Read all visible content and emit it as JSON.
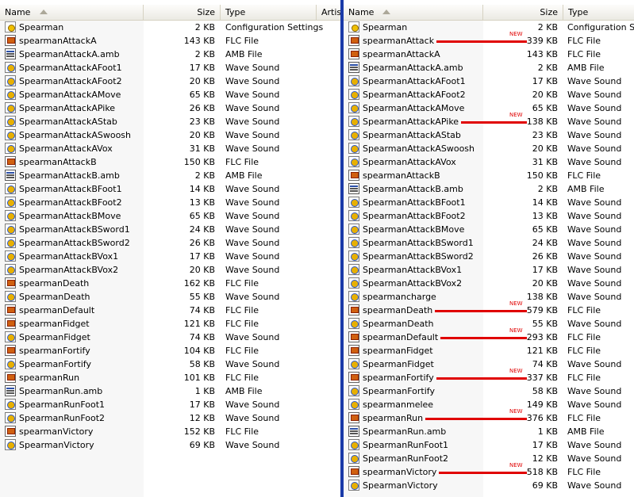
{
  "left": {
    "columns": {
      "name": "Name",
      "size": "Size",
      "type": "Type",
      "artist": "Artis"
    },
    "files": [
      {
        "name": "Spearman",
        "size": "2 KB",
        "type": "Configuration Settings",
        "icon": "config-icon"
      },
      {
        "name": "spearmanAttackA",
        "size": "143 KB",
        "type": "FLC File",
        "icon": "flc-icon"
      },
      {
        "name": "SpearmanAttackA.amb",
        "size": "2 KB",
        "type": "AMB File",
        "icon": "amb-icon"
      },
      {
        "name": "SpearmanAttackAFoot1",
        "size": "17 KB",
        "type": "Wave Sound",
        "icon": "wave-icon"
      },
      {
        "name": "SpearmanAttackAFoot2",
        "size": "20 KB",
        "type": "Wave Sound",
        "icon": "wave-icon"
      },
      {
        "name": "SpearmanAttackAMove",
        "size": "65 KB",
        "type": "Wave Sound",
        "icon": "wave-icon"
      },
      {
        "name": "SpearmanAttackAPike",
        "size": "26 KB",
        "type": "Wave Sound",
        "icon": "wave-icon"
      },
      {
        "name": "SpearmanAttackAStab",
        "size": "23 KB",
        "type": "Wave Sound",
        "icon": "wave-icon"
      },
      {
        "name": "SpearmanAttackASwoosh",
        "size": "20 KB",
        "type": "Wave Sound",
        "icon": "wave-icon"
      },
      {
        "name": "SpearmanAttackAVox",
        "size": "31 KB",
        "type": "Wave Sound",
        "icon": "wave-icon"
      },
      {
        "name": "spearmanAttackB",
        "size": "150 KB",
        "type": "FLC File",
        "icon": "flc-icon"
      },
      {
        "name": "SpearmanAttackB.amb",
        "size": "2 KB",
        "type": "AMB File",
        "icon": "amb-icon"
      },
      {
        "name": "SpearmanAttackBFoot1",
        "size": "14 KB",
        "type": "Wave Sound",
        "icon": "wave-icon"
      },
      {
        "name": "SpearmanAttackBFoot2",
        "size": "13 KB",
        "type": "Wave Sound",
        "icon": "wave-icon"
      },
      {
        "name": "SpearmanAttackBMove",
        "size": "65 KB",
        "type": "Wave Sound",
        "icon": "wave-icon"
      },
      {
        "name": "SpearmanAttackBSword1",
        "size": "24 KB",
        "type": "Wave Sound",
        "icon": "wave-icon"
      },
      {
        "name": "SpearmanAttackBSword2",
        "size": "26 KB",
        "type": "Wave Sound",
        "icon": "wave-icon"
      },
      {
        "name": "SpearmanAttackBVox1",
        "size": "17 KB",
        "type": "Wave Sound",
        "icon": "wave-icon"
      },
      {
        "name": "SpearmanAttackBVox2",
        "size": "20 KB",
        "type": "Wave Sound",
        "icon": "wave-icon"
      },
      {
        "name": "spearmanDeath",
        "size": "162 KB",
        "type": "FLC File",
        "icon": "flc-icon"
      },
      {
        "name": "SpearmanDeath",
        "size": "55 KB",
        "type": "Wave Sound",
        "icon": "wave-icon"
      },
      {
        "name": "spearmanDefault",
        "size": "74 KB",
        "type": "FLC File",
        "icon": "flc-icon"
      },
      {
        "name": "spearmanFidget",
        "size": "121 KB",
        "type": "FLC File",
        "icon": "flc-icon"
      },
      {
        "name": "SpearmanFidget",
        "size": "74 KB",
        "type": "Wave Sound",
        "icon": "wave-icon"
      },
      {
        "name": "spearmanFortify",
        "size": "104 KB",
        "type": "FLC File",
        "icon": "flc-icon"
      },
      {
        "name": "SpearmanFortify",
        "size": "58 KB",
        "type": "Wave Sound",
        "icon": "wave-icon"
      },
      {
        "name": "spearmanRun",
        "size": "101 KB",
        "type": "FLC File",
        "icon": "flc-icon"
      },
      {
        "name": "SpearmanRun.amb",
        "size": "1 KB",
        "type": "AMB File",
        "icon": "amb-icon"
      },
      {
        "name": "SpearmanRunFoot1",
        "size": "17 KB",
        "type": "Wave Sound",
        "icon": "wave-icon"
      },
      {
        "name": "SpearmanRunFoot2",
        "size": "12 KB",
        "type": "Wave Sound",
        "icon": "wave-icon"
      },
      {
        "name": "spearmanVictory",
        "size": "152 KB",
        "type": "FLC File",
        "icon": "flc-icon"
      },
      {
        "name": "SpearmanVictory",
        "size": "69 KB",
        "type": "Wave Sound",
        "icon": "wave-icon"
      }
    ]
  },
  "right": {
    "columns": {
      "name": "Name",
      "size": "Size",
      "type": "Type"
    },
    "new_label": "NEW",
    "marker_color": "#e00000",
    "files": [
      {
        "name": "Spearman",
        "size": "2 KB",
        "type": "Configuration Settings",
        "icon": "config-icon"
      },
      {
        "name": "spearmanAttack",
        "size": "339 KB",
        "type": "FLC File",
        "icon": "flc-icon",
        "new": true
      },
      {
        "name": "spearmanAttackA",
        "size": "143 KB",
        "type": "FLC File",
        "icon": "flc-icon"
      },
      {
        "name": "SpearmanAttackA.amb",
        "size": "2 KB",
        "type": "AMB File",
        "icon": "amb-icon"
      },
      {
        "name": "SpearmanAttackAFoot1",
        "size": "17 KB",
        "type": "Wave Sound",
        "icon": "wave-icon"
      },
      {
        "name": "SpearmanAttackAFoot2",
        "size": "20 KB",
        "type": "Wave Sound",
        "icon": "wave-icon"
      },
      {
        "name": "SpearmanAttackAMove",
        "size": "65 KB",
        "type": "Wave Sound",
        "icon": "wave-icon"
      },
      {
        "name": "SpearmanAttackAPike",
        "size": "138 KB",
        "type": "Wave Sound",
        "icon": "wave-icon",
        "new": true
      },
      {
        "name": "SpearmanAttackAStab",
        "size": "23 KB",
        "type": "Wave Sound",
        "icon": "wave-icon"
      },
      {
        "name": "SpearmanAttackASwoosh",
        "size": "20 KB",
        "type": "Wave Sound",
        "icon": "wave-icon"
      },
      {
        "name": "SpearmanAttackAVox",
        "size": "31 KB",
        "type": "Wave Sound",
        "icon": "wave-icon"
      },
      {
        "name": "spearmanAttackB",
        "size": "150 KB",
        "type": "FLC File",
        "icon": "flc-icon"
      },
      {
        "name": "SpearmanAttackB.amb",
        "size": "2 KB",
        "type": "AMB File",
        "icon": "amb-icon"
      },
      {
        "name": "SpearmanAttackBFoot1",
        "size": "14 KB",
        "type": "Wave Sound",
        "icon": "wave-icon"
      },
      {
        "name": "SpearmanAttackBFoot2",
        "size": "13 KB",
        "type": "Wave Sound",
        "icon": "wave-icon"
      },
      {
        "name": "SpearmanAttackBMove",
        "size": "65 KB",
        "type": "Wave Sound",
        "icon": "wave-icon"
      },
      {
        "name": "SpearmanAttackBSword1",
        "size": "24 KB",
        "type": "Wave Sound",
        "icon": "wave-icon"
      },
      {
        "name": "SpearmanAttackBSword2",
        "size": "26 KB",
        "type": "Wave Sound",
        "icon": "wave-icon"
      },
      {
        "name": "SpearmanAttackBVox1",
        "size": "17 KB",
        "type": "Wave Sound",
        "icon": "wave-icon"
      },
      {
        "name": "SpearmanAttackBVox2",
        "size": "20 KB",
        "type": "Wave Sound",
        "icon": "wave-icon"
      },
      {
        "name": "spearmancharge",
        "size": "138 KB",
        "type": "Wave Sound",
        "icon": "wave-icon"
      },
      {
        "name": "spearmanDeath",
        "size": "579 KB",
        "type": "FLC File",
        "icon": "flc-icon",
        "new": true
      },
      {
        "name": "SpearmanDeath",
        "size": "55 KB",
        "type": "Wave Sound",
        "icon": "wave-icon"
      },
      {
        "name": "spearmanDefault",
        "size": "293 KB",
        "type": "FLC File",
        "icon": "flc-icon",
        "new": true
      },
      {
        "name": "spearmanFidget",
        "size": "121 KB",
        "type": "FLC File",
        "icon": "flc-icon"
      },
      {
        "name": "SpearmanFidget",
        "size": "74 KB",
        "type": "Wave Sound",
        "icon": "wave-icon"
      },
      {
        "name": "spearmanFortify",
        "size": "337 KB",
        "type": "FLC File",
        "icon": "flc-icon",
        "new": true
      },
      {
        "name": "SpearmanFortify",
        "size": "58 KB",
        "type": "Wave Sound",
        "icon": "wave-icon"
      },
      {
        "name": "spearmanmelee",
        "size": "149 KB",
        "type": "Wave Sound",
        "icon": "wave-icon"
      },
      {
        "name": "spearmanRun",
        "size": "376 KB",
        "type": "FLC File",
        "icon": "flc-icon",
        "new": true
      },
      {
        "name": "SpearmanRun.amb",
        "size": "1 KB",
        "type": "AMB File",
        "icon": "amb-icon"
      },
      {
        "name": "SpearmanRunFoot1",
        "size": "17 KB",
        "type": "Wave Sound",
        "icon": "wave-icon"
      },
      {
        "name": "SpearmanRunFoot2",
        "size": "12 KB",
        "type": "Wave Sound",
        "icon": "wave-icon"
      },
      {
        "name": "spearmanVictory",
        "size": "518 KB",
        "type": "FLC File",
        "icon": "flc-icon",
        "new": true
      },
      {
        "name": "SpearmanVictory",
        "size": "69 KB",
        "type": "Wave Sound",
        "icon": "wave-icon"
      }
    ]
  }
}
